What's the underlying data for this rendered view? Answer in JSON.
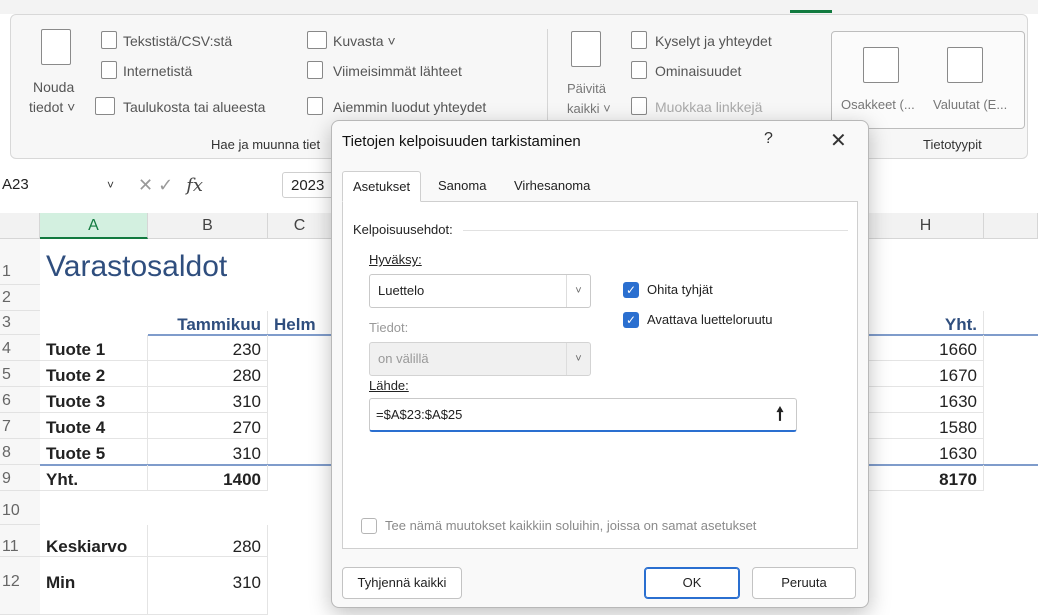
{
  "ribbon": {
    "get_data_label_1": "Nouda",
    "get_data_label_2": "tiedot ˅",
    "from_text_csv": "Tekstistä/CSV:stä",
    "from_web": "Internetistä",
    "from_table": "Taulukosta tai alueesta",
    "from_picture": "Kuvasta ˅",
    "recent_sources": "Viimeisimmät lähteet",
    "existing_connections": "Aiemmin luodut yhteydet",
    "group_get_transform": "Hae ja muunna tiet",
    "refresh_all_1": "Päivitä",
    "refresh_all_2": "kaikki ˅",
    "queries_connections": "Kyselyt ja yhteydet",
    "properties": "Ominaisuudet",
    "edit_links": "Muokkaa linkkejä",
    "stocks": "Osakkeet (...",
    "currencies": "Valuutat (E...",
    "group_data_types": "Tietotyypit"
  },
  "formula_bar": {
    "name_box": "A23",
    "name_box_arrow": "˅",
    "cancel_icon_char": "✕",
    "enter_icon_char": "✓",
    "fx_label": "fx",
    "formula_value": "2023"
  },
  "sheet": {
    "columns": [
      "A",
      "B",
      "C",
      "H"
    ],
    "row_numbers": [
      "1",
      "2",
      "3",
      "4",
      "5",
      "6",
      "7",
      "8",
      "9",
      "10",
      "11",
      "12"
    ],
    "title": "Varastosaldot",
    "header_b": "Tammikuu",
    "header_c": "Helm",
    "header_h": "Yht.",
    "rows": [
      {
        "label": "Tuote 1",
        "b": "230",
        "h": "1660"
      },
      {
        "label": "Tuote 2",
        "b": "280",
        "h": "1670"
      },
      {
        "label": "Tuote 3",
        "b": "310",
        "h": "1630"
      },
      {
        "label": "Tuote 4",
        "b": "270",
        "h": "1580"
      },
      {
        "label": "Tuote 5",
        "b": "310",
        "h": "1630"
      }
    ],
    "total": {
      "label": "Yht.",
      "b": "1400",
      "h": "8170"
    },
    "avg": {
      "label": "Keskiarvo",
      "b": "280"
    },
    "min": {
      "label": "Min",
      "b": "310"
    }
  },
  "dialog": {
    "title": "Tietojen kelpoisuuden tarkistaminen",
    "help": "?",
    "close": "✕",
    "tabs": [
      "Asetukset",
      "Sanoma",
      "Virhesanoma"
    ],
    "criteria_group": "Kelpoisuusehdot:",
    "allow_label": "Hyväksy:",
    "allow_value": "Luettelo",
    "ignore_blank": "Ohita tyhjät",
    "dropdown_in_cell": "Avattava luetteloruutu",
    "data_label": "Tiedot:",
    "data_value": "on välillä",
    "source_label": "Lähde:",
    "source_value": "=$A$23:$A$25",
    "source_btn": "🠕",
    "apply_all": "Tee nämä muutokset kaikkiin soluihin, joissa on samat asetukset",
    "clear_all": "Tyhjennä kaikki",
    "ok": "OK",
    "cancel": "Peruuta",
    "check_mark": "✓",
    "dropdown_arrow": "˅"
  },
  "colors": {
    "excel_green": "#117a3f",
    "accent_blue": "#2a6fd0",
    "heading_blue": "#2f4e7e"
  }
}
